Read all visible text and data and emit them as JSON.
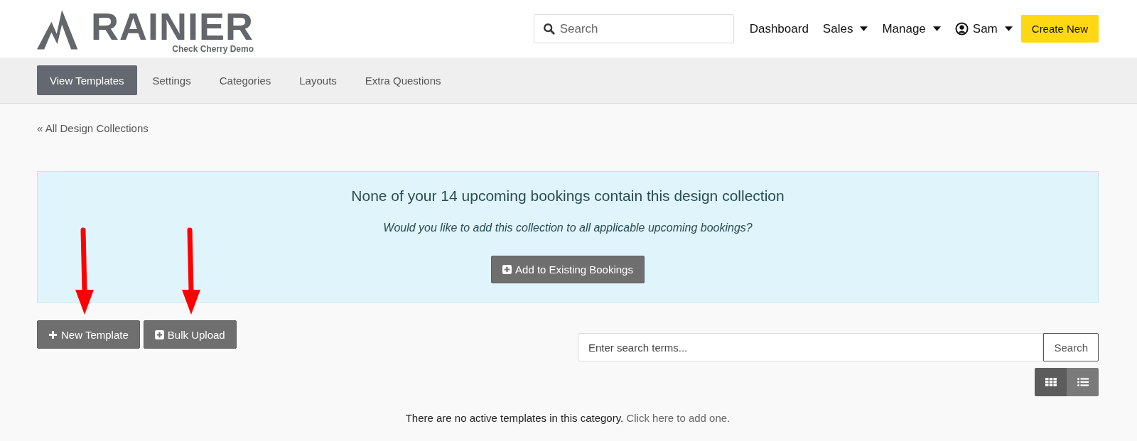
{
  "logo": {
    "name": "RAINIER",
    "tagline": "Check Cherry Demo"
  },
  "header": {
    "search": {
      "placeholder": "Search"
    },
    "nav": [
      {
        "label": "Dashboard",
        "kind": "link"
      },
      {
        "label": "Sales",
        "kind": "menu"
      },
      {
        "label": "Manage",
        "kind": "menu"
      },
      {
        "label": "Sam",
        "kind": "user-menu"
      }
    ],
    "create_button": "Create New"
  },
  "tabs": [
    {
      "label": "View Templates",
      "selected": true
    },
    {
      "label": "Settings",
      "selected": false
    },
    {
      "label": "Categories",
      "selected": false
    },
    {
      "label": "Layouts",
      "selected": false
    },
    {
      "label": "Extra Questions",
      "selected": false
    }
  ],
  "breadcrumb": "« All Design Collections",
  "alert": {
    "title": "None of your 14 upcoming bookings contain this design collection",
    "question": "Would you like to add this collection to all applicable upcoming bookings?",
    "button": "Add to Existing Bookings"
  },
  "actions": [
    {
      "label": "New Template",
      "kind": "plus",
      "highlighted": true
    },
    {
      "label": "Bulk Upload",
      "kind": "plus-square",
      "highlighted": true
    }
  ],
  "template_search": {
    "placeholder": "Enter search terms...",
    "button": "Search"
  },
  "view_toggle": [
    {
      "kind": "grid",
      "selected": true
    },
    {
      "kind": "list",
      "selected": false
    }
  ],
  "empty_message": {
    "text": "There are no active templates in this category.",
    "link": "Click here to add one."
  }
}
